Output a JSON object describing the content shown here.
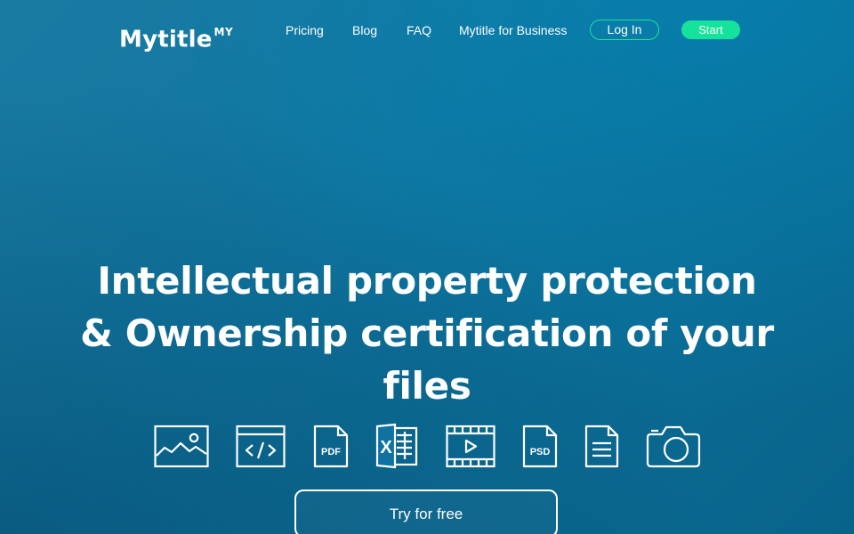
{
  "brand": {
    "name": "Mytitle",
    "superscript": "MY"
  },
  "nav": {
    "pricing": "Pricing",
    "blog": "Blog",
    "faq": "FAQ",
    "business": "Mytitle for Business",
    "login": "Log In",
    "start": "Start"
  },
  "hero": {
    "headline_lines": [
      "Intellectual property protection",
      "& Ownership certification of your",
      "files"
    ],
    "cta": "Try for free"
  },
  "file_types": {
    "pdf_label": "PDF",
    "excel_label": "X",
    "psd_label": "PSD",
    "icons": [
      "image-icon",
      "code-icon",
      "pdf-icon",
      "excel-icon",
      "video-icon",
      "psd-icon",
      "document-icon",
      "camera-icon"
    ]
  },
  "colors": {
    "accent": "#16e39b",
    "background_start": "#1a7ba2",
    "background_end": "#08638a",
    "text": "#ffffff"
  }
}
